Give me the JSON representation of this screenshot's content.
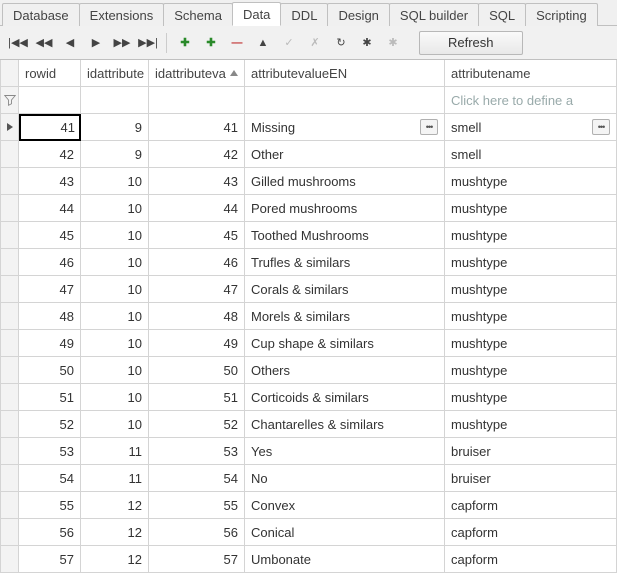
{
  "tabs": [
    "Database",
    "Extensions",
    "Schema",
    "Data",
    "DDL",
    "Design",
    "SQL builder",
    "SQL",
    "Scripting"
  ],
  "active_tab_index": 3,
  "toolbar": {
    "refresh": "Refresh",
    "buttons": {
      "first": "|◀◀",
      "prev_page": "◀◀",
      "prev": "◀",
      "next": "▶",
      "next_page": "▶▶",
      "last": "▶▶|",
      "insert": "✚",
      "insert_child": "✚",
      "delete": "—",
      "move_up": "▲",
      "commit": "✓",
      "rollback": "✗",
      "refresh_small": "↻",
      "filter_star": "✱",
      "filter_star2": "✱"
    }
  },
  "columns": [
    "rowid",
    "idattribute",
    "idattributeva",
    "attributevalueEN",
    "attributename"
  ],
  "sorted_column_index": 2,
  "filter_hint": "Click here to define a",
  "rows": [
    {
      "rowid": 41,
      "idattribute": 9,
      "idattributeva": 41,
      "attributevalueEN": "Missing",
      "attributename": "smell",
      "current": true
    },
    {
      "rowid": 42,
      "idattribute": 9,
      "idattributeva": 42,
      "attributevalueEN": "Other",
      "attributename": "smell"
    },
    {
      "rowid": 43,
      "idattribute": 10,
      "idattributeva": 43,
      "attributevalueEN": "Gilled mushrooms",
      "attributename": "mushtype"
    },
    {
      "rowid": 44,
      "idattribute": 10,
      "idattributeva": 44,
      "attributevalueEN": "Pored mushrooms",
      "attributename": "mushtype"
    },
    {
      "rowid": 45,
      "idattribute": 10,
      "idattributeva": 45,
      "attributevalueEN": "Toothed Mushrooms",
      "attributename": "mushtype"
    },
    {
      "rowid": 46,
      "idattribute": 10,
      "idattributeva": 46,
      "attributevalueEN": "Trufles & similars",
      "attributename": "mushtype"
    },
    {
      "rowid": 47,
      "idattribute": 10,
      "idattributeva": 47,
      "attributevalueEN": "Corals & similars",
      "attributename": "mushtype"
    },
    {
      "rowid": 48,
      "idattribute": 10,
      "idattributeva": 48,
      "attributevalueEN": "Morels & similars",
      "attributename": "mushtype"
    },
    {
      "rowid": 49,
      "idattribute": 10,
      "idattributeva": 49,
      "attributevalueEN": "Cup shape & similars",
      "attributename": "mushtype"
    },
    {
      "rowid": 50,
      "idattribute": 10,
      "idattributeva": 50,
      "attributevalueEN": "Others",
      "attributename": "mushtype"
    },
    {
      "rowid": 51,
      "idattribute": 10,
      "idattributeva": 51,
      "attributevalueEN": "Corticoids & similars",
      "attributename": "mushtype"
    },
    {
      "rowid": 52,
      "idattribute": 10,
      "idattributeva": 52,
      "attributevalueEN": "Chantarelles & similars",
      "attributename": "mushtype"
    },
    {
      "rowid": 53,
      "idattribute": 11,
      "idattributeva": 53,
      "attributevalueEN": "Yes",
      "attributename": "bruiser"
    },
    {
      "rowid": 54,
      "idattribute": 11,
      "idattributeva": 54,
      "attributevalueEN": "No",
      "attributename": "bruiser"
    },
    {
      "rowid": 55,
      "idattribute": 12,
      "idattributeva": 55,
      "attributevalueEN": "Convex",
      "attributename": "capform"
    },
    {
      "rowid": 56,
      "idattribute": 12,
      "idattributeva": 56,
      "attributevalueEN": "Conical",
      "attributename": "capform"
    },
    {
      "rowid": 57,
      "idattribute": 12,
      "idattributeva": 57,
      "attributevalueEN": "Umbonate",
      "attributename": "capform"
    }
  ]
}
